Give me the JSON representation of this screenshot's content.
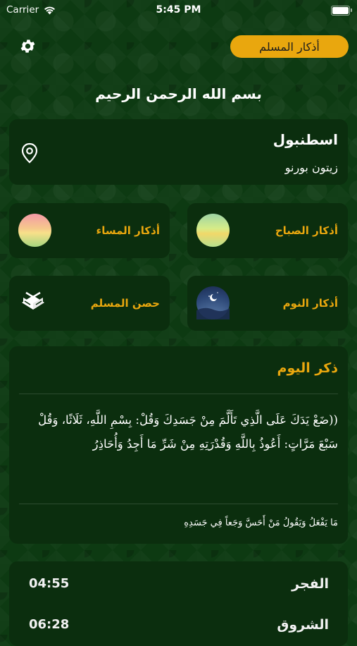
{
  "status_bar": {
    "carrier": "Carrier",
    "time": "5:45 PM",
    "battery_level": 1.0
  },
  "header": {
    "app_title": "أذكار المسلم",
    "basmala": "بسم الله الرحمن الرحيم"
  },
  "location": {
    "city": "اسطنبول",
    "area": "زيتون بورنو"
  },
  "tiles": {
    "morning": "أذكار الصباح",
    "evening": "أذكار المساء",
    "sleep": "أذكار النوم",
    "hisn": "حصن المسلم"
  },
  "zikr_of_day": {
    "title": "ذكر اليوم",
    "text": "((ضَعْ يَدَكَ عَلَى الَّذِي تَأَلَّمَ مِنْ جَسَدِكَ وَقُلْ: بِسْمِ اللَّهِ، ثَلَاثًا، وَقُلْ سَبْعَ مَرَّاتٍ: أَعُوذُ بِاللَّهِ وَقُدْرَتِهِ مِنْ شَرِّ مَا أَجِدُ وَأُحَاذِرُ",
    "note": "مَا يَفْعَلُ وَيَقُولُ مَنْ أَحَسَّ وَجَعاً فِي جَسَدِهِ"
  },
  "prayers": [
    {
      "name": "الفجر",
      "time": "04:55"
    },
    {
      "name": "الشروق",
      "time": "06:28"
    }
  ],
  "colors": {
    "accent": "#e9a70e",
    "card": "#0b2e0e",
    "background": "#0d3a12"
  }
}
